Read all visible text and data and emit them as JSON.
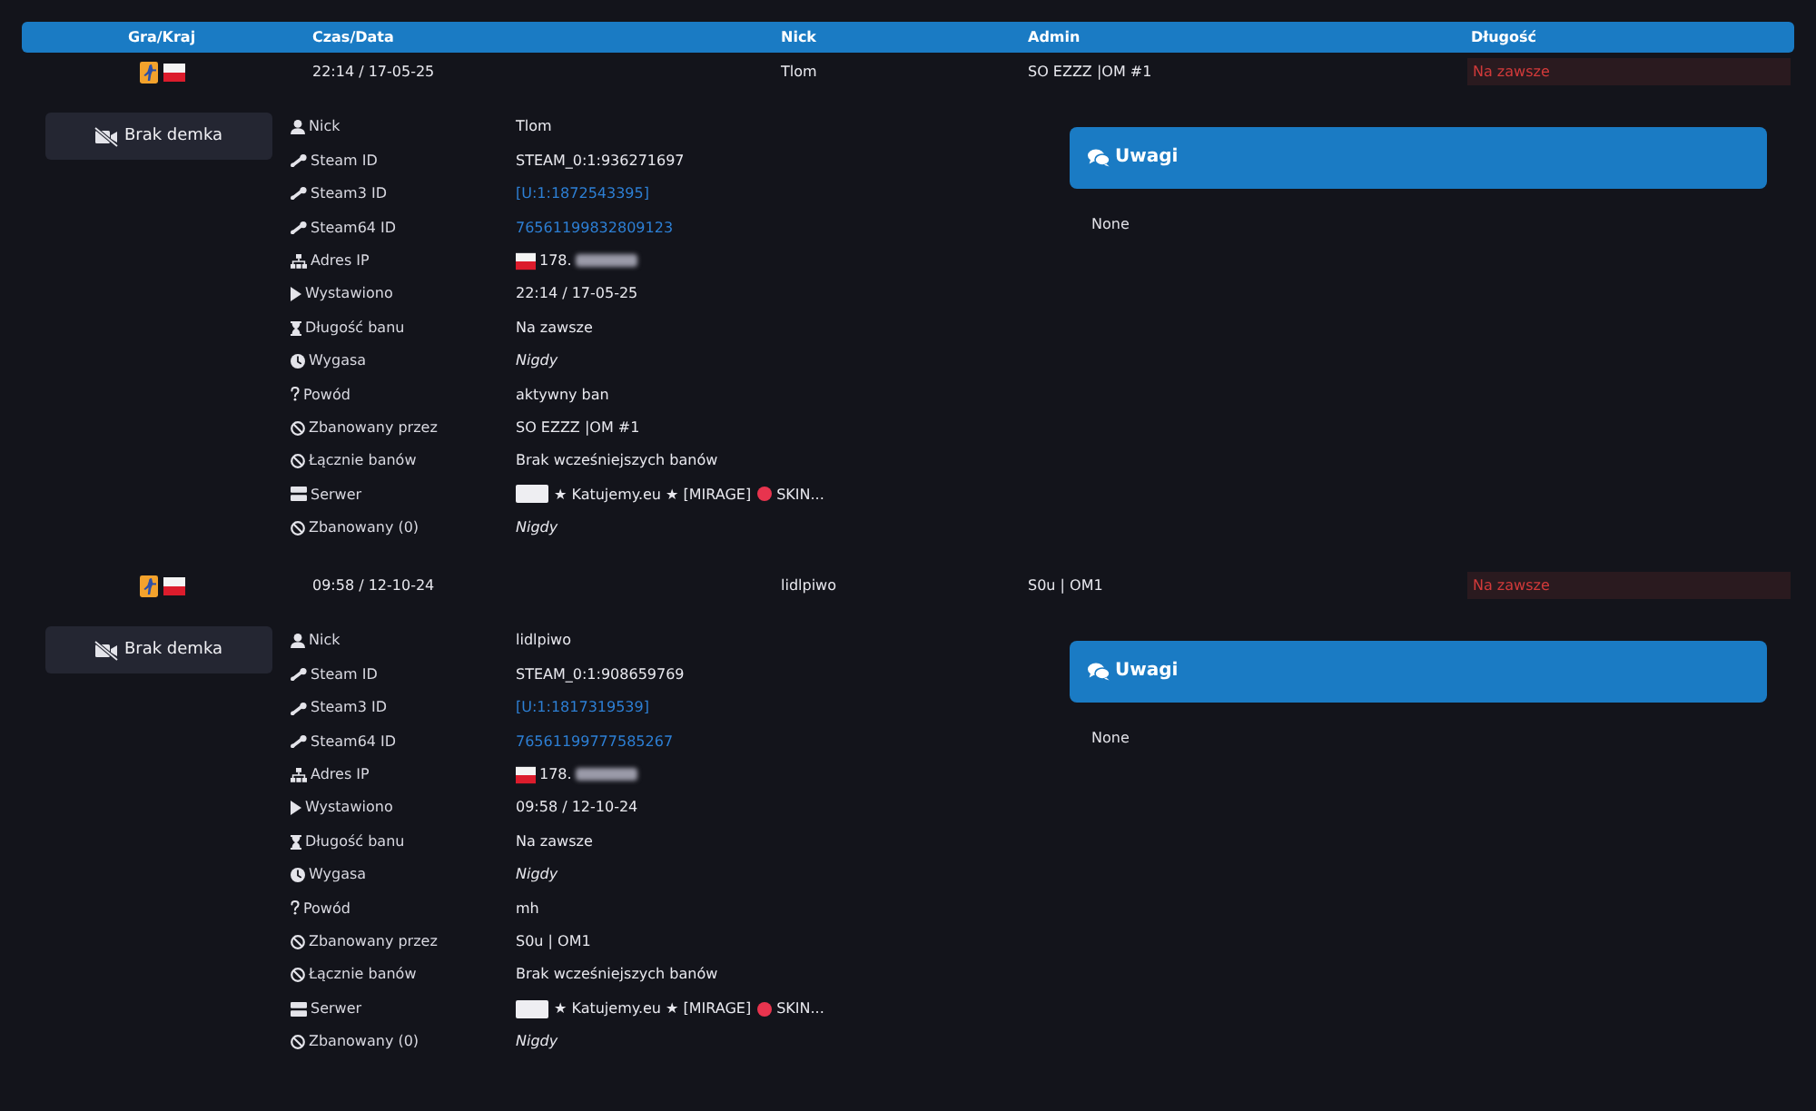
{
  "table": {
    "columns": [
      "Gra/Kraj",
      "Czas/Data",
      "Nick",
      "Admin",
      "Długość"
    ],
    "rows": [
      {
        "time": "22:14 / 17-05-25",
        "nick": "Tlom",
        "admin": "SO EZZZ |OM #1",
        "length": "Na zawsze",
        "details": {
          "demo_button": "Brak demka",
          "fields": [
            {
              "label": "Nick",
              "kind": "text",
              "value": "Tlom"
            },
            {
              "label": "Steam ID",
              "kind": "text",
              "value": "STEAM_0:1:936271697"
            },
            {
              "label": "Steam3 ID",
              "kind": "link",
              "value": "[U:1:1872543395]"
            },
            {
              "label": "Steam64 ID",
              "kind": "link",
              "value": "76561199832809123"
            },
            {
              "label": "Adres IP",
              "kind": "ip",
              "value": "178."
            },
            {
              "label": "Wystawiono",
              "kind": "text",
              "value": "22:14 / 17-05-25"
            },
            {
              "label": "Długość banu",
              "kind": "text",
              "value": "Na zawsze"
            },
            {
              "label": "Wygasa",
              "kind": "italic",
              "value": "Nigdy"
            },
            {
              "label": "Powód",
              "kind": "text",
              "value": "aktywny ban"
            },
            {
              "label": "Zbanowany przez",
              "kind": "text",
              "value": "SO EZZZ |OM #1"
            },
            {
              "label": "Łącznie banów",
              "kind": "text",
              "value": "Brak wcześniejszych banów"
            },
            {
              "label": "Serwer",
              "kind": "server",
              "value": "★ Katujemy.eu ★ [MIRAGE]",
              "value_suffix": "SKIN..."
            },
            {
              "label": "Zbanowany (0)",
              "kind": "italic",
              "value": "Nigdy"
            }
          ],
          "notes": {
            "title": "Uwagi",
            "text": "None"
          }
        }
      },
      {
        "time": "09:58 / 12-10-24",
        "nick": "lidlpiwo",
        "admin": "S0u | OM1",
        "length": "Na zawsze",
        "details": {
          "demo_button": "Brak demka",
          "fields": [
            {
              "label": "Nick",
              "kind": "text",
              "value": "lidlpiwo"
            },
            {
              "label": "Steam ID",
              "kind": "text",
              "value": "STEAM_0:1:908659769"
            },
            {
              "label": "Steam3 ID",
              "kind": "link",
              "value": "[U:1:1817319539]"
            },
            {
              "label": "Steam64 ID",
              "kind": "link",
              "value": "76561199777585267"
            },
            {
              "label": "Adres IP",
              "kind": "ip",
              "value": "178."
            },
            {
              "label": "Wystawiono",
              "kind": "text",
              "value": "09:58 / 12-10-24"
            },
            {
              "label": "Długość banu",
              "kind": "text",
              "value": "Na zawsze"
            },
            {
              "label": "Wygasa",
              "kind": "italic",
              "value": "Nigdy"
            },
            {
              "label": "Powód",
              "kind": "text",
              "value": "mh"
            },
            {
              "label": "Zbanowany przez",
              "kind": "text",
              "value": "S0u | OM1"
            },
            {
              "label": "Łącznie banów",
              "kind": "text",
              "value": "Brak wcześniejszych banów"
            },
            {
              "label": "Serwer",
              "kind": "server",
              "value": "★ Katujemy.eu ★ [MIRAGE]",
              "value_suffix": "SKIN..."
            },
            {
              "label": "Zbanowany (0)",
              "kind": "italic",
              "value": "Nigdy"
            }
          ],
          "notes": {
            "title": "Uwagi",
            "text": "None"
          }
        }
      }
    ]
  }
}
